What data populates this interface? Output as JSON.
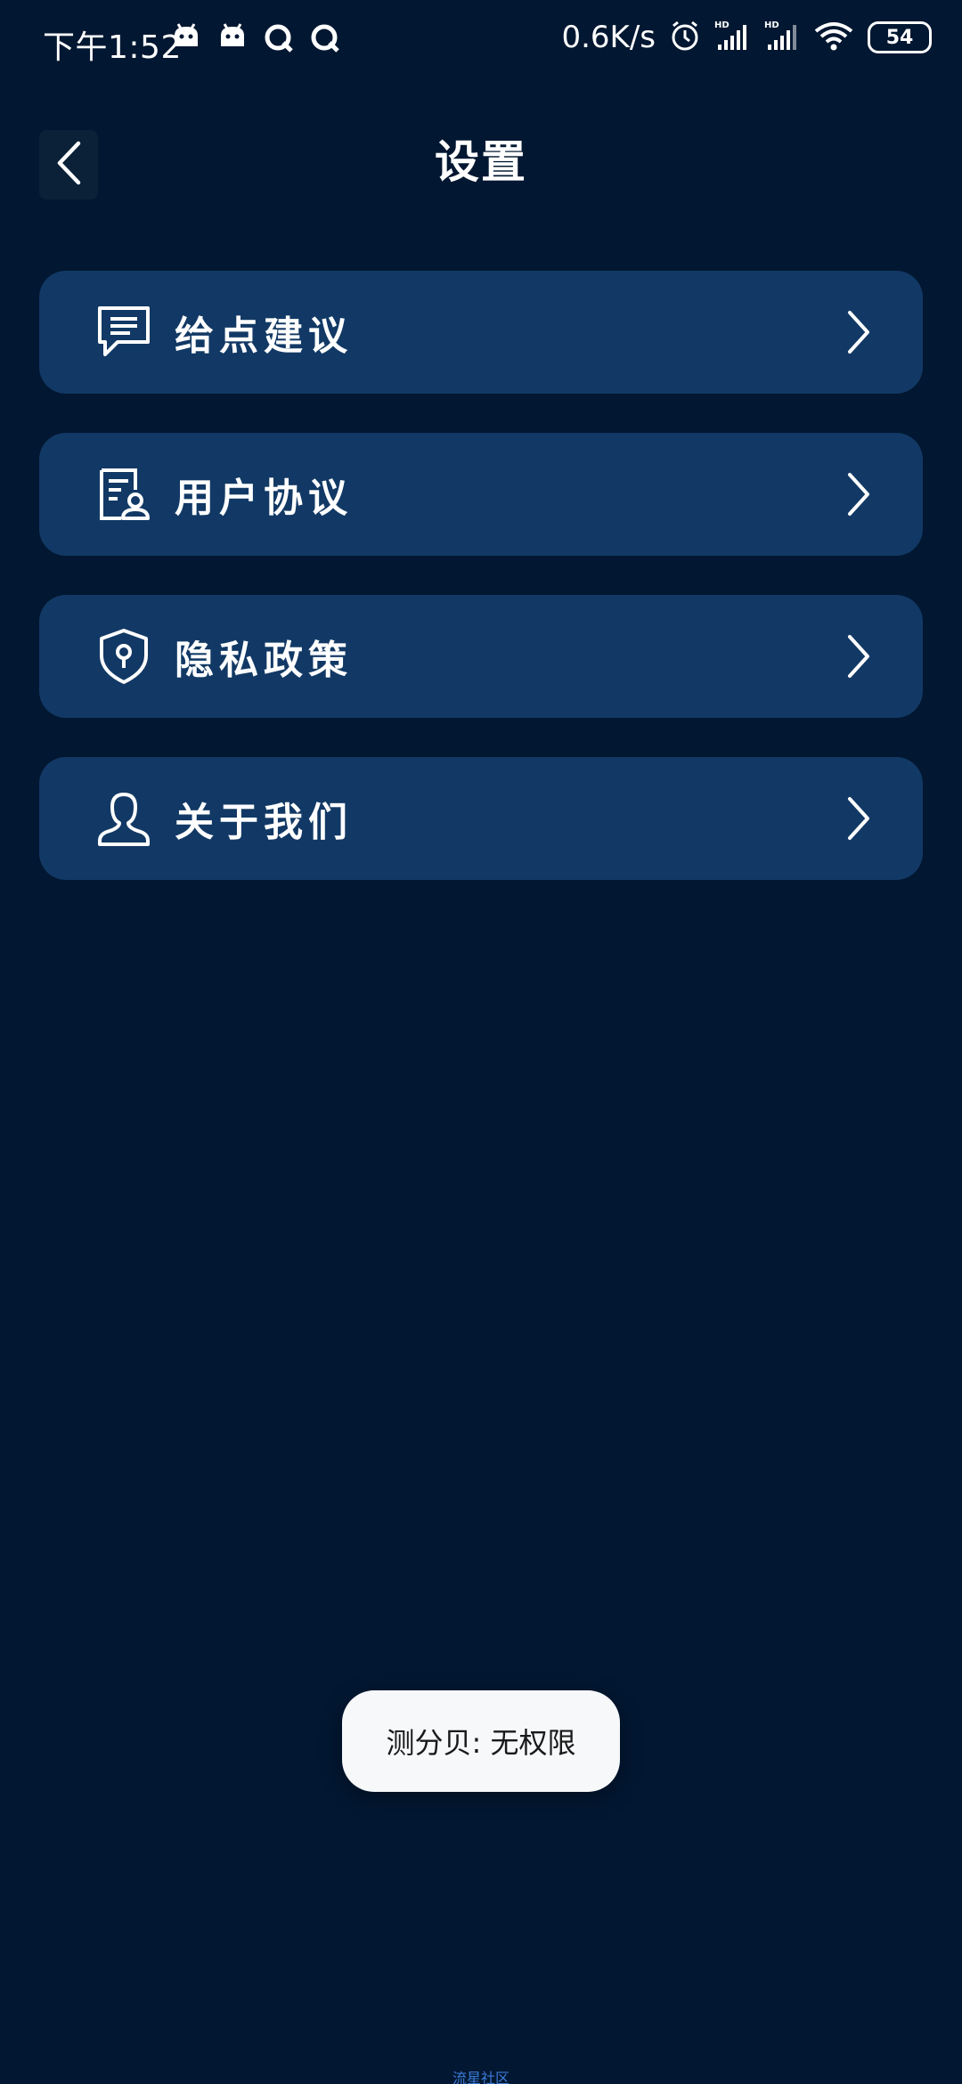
{
  "status_bar": {
    "time": "下午1:52",
    "net_speed": "0.6K/s",
    "battery": "54",
    "icons": [
      "android-icon",
      "android-icon",
      "q-app-icon",
      "q-app-icon",
      "alarm-icon",
      "signal-hd-icon",
      "signal-hd-icon",
      "wifi-icon",
      "battery-icon"
    ]
  },
  "header": {
    "title": "设置"
  },
  "menu": {
    "items": [
      {
        "label": "给点建议",
        "icon": "feedback-icon"
      },
      {
        "label": "用户协议",
        "icon": "agreement-icon"
      },
      {
        "label": "隐私政策",
        "icon": "privacy-shield-icon"
      },
      {
        "label": "关于我们",
        "icon": "about-user-icon"
      }
    ]
  },
  "toast": {
    "text": "测分贝: 无权限"
  },
  "watermark": {
    "text": "流星社区"
  },
  "colors": {
    "background": "#021731",
    "card": "#123965",
    "toast_bg": "#f6f8fa",
    "text": "#ffffff"
  }
}
